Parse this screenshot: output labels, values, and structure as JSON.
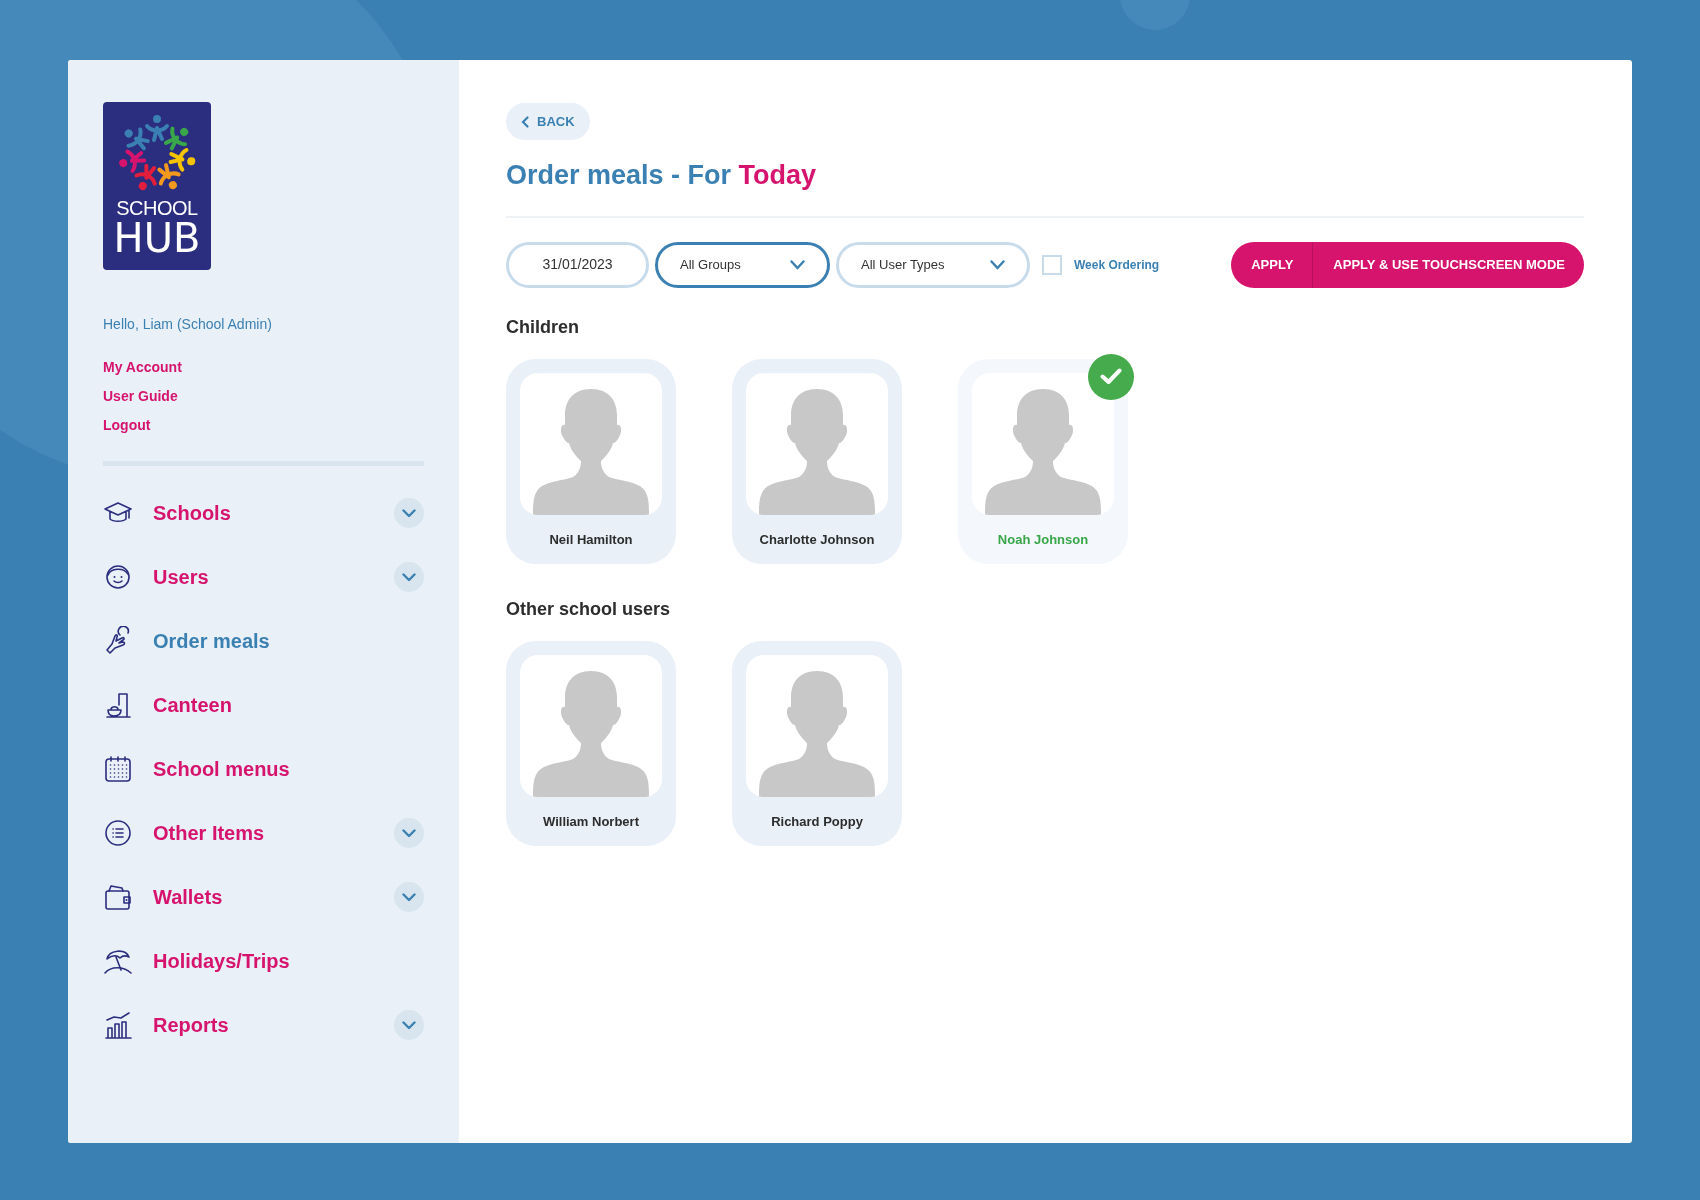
{
  "logo": {
    "line_1": "SCHOOL",
    "line_2": "HUB"
  },
  "sidebar": {
    "greeting": "Hello, Liam (School Admin)",
    "account_links": [
      "My Account",
      "User Guide",
      "Logout"
    ],
    "nav": [
      {
        "label": "Schools",
        "selected": false,
        "expandable": true
      },
      {
        "label": "Users",
        "selected": false,
        "expandable": true
      },
      {
        "label": "Order meals",
        "selected": true,
        "expandable": false
      },
      {
        "label": "Canteen",
        "selected": false,
        "expandable": false
      },
      {
        "label": "School menus",
        "selected": false,
        "expandable": false
      },
      {
        "label": "Other Items",
        "selected": false,
        "expandable": true
      },
      {
        "label": "Wallets",
        "selected": false,
        "expandable": true
      },
      {
        "label": "Holidays/Trips",
        "selected": false,
        "expandable": false
      },
      {
        "label": "Reports",
        "selected": false,
        "expandable": true
      }
    ]
  },
  "back_button": "BACK",
  "title": {
    "main": "Order meals - For",
    "highlight": "Today"
  },
  "filters": {
    "date": "31/01/2023",
    "group": "All Groups",
    "user_type": "All User Types",
    "week_ordering": {
      "label": "Week Ordering",
      "checked": false
    },
    "buttons": [
      "APPLY",
      "APPLY & USE TOUCHSCREEN MODE"
    ]
  },
  "sections": [
    {
      "heading": "Children",
      "users": [
        {
          "name": "Neil Hamilton",
          "selected": false
        },
        {
          "name": "Charlotte Johnson",
          "selected": false
        },
        {
          "name": "Noah Johnson",
          "selected": true
        }
      ]
    },
    {
      "heading": "Other school users",
      "users": [
        {
          "name": "William Norbert",
          "selected": false
        },
        {
          "name": "Richard Poppy",
          "selected": false
        }
      ]
    }
  ]
}
